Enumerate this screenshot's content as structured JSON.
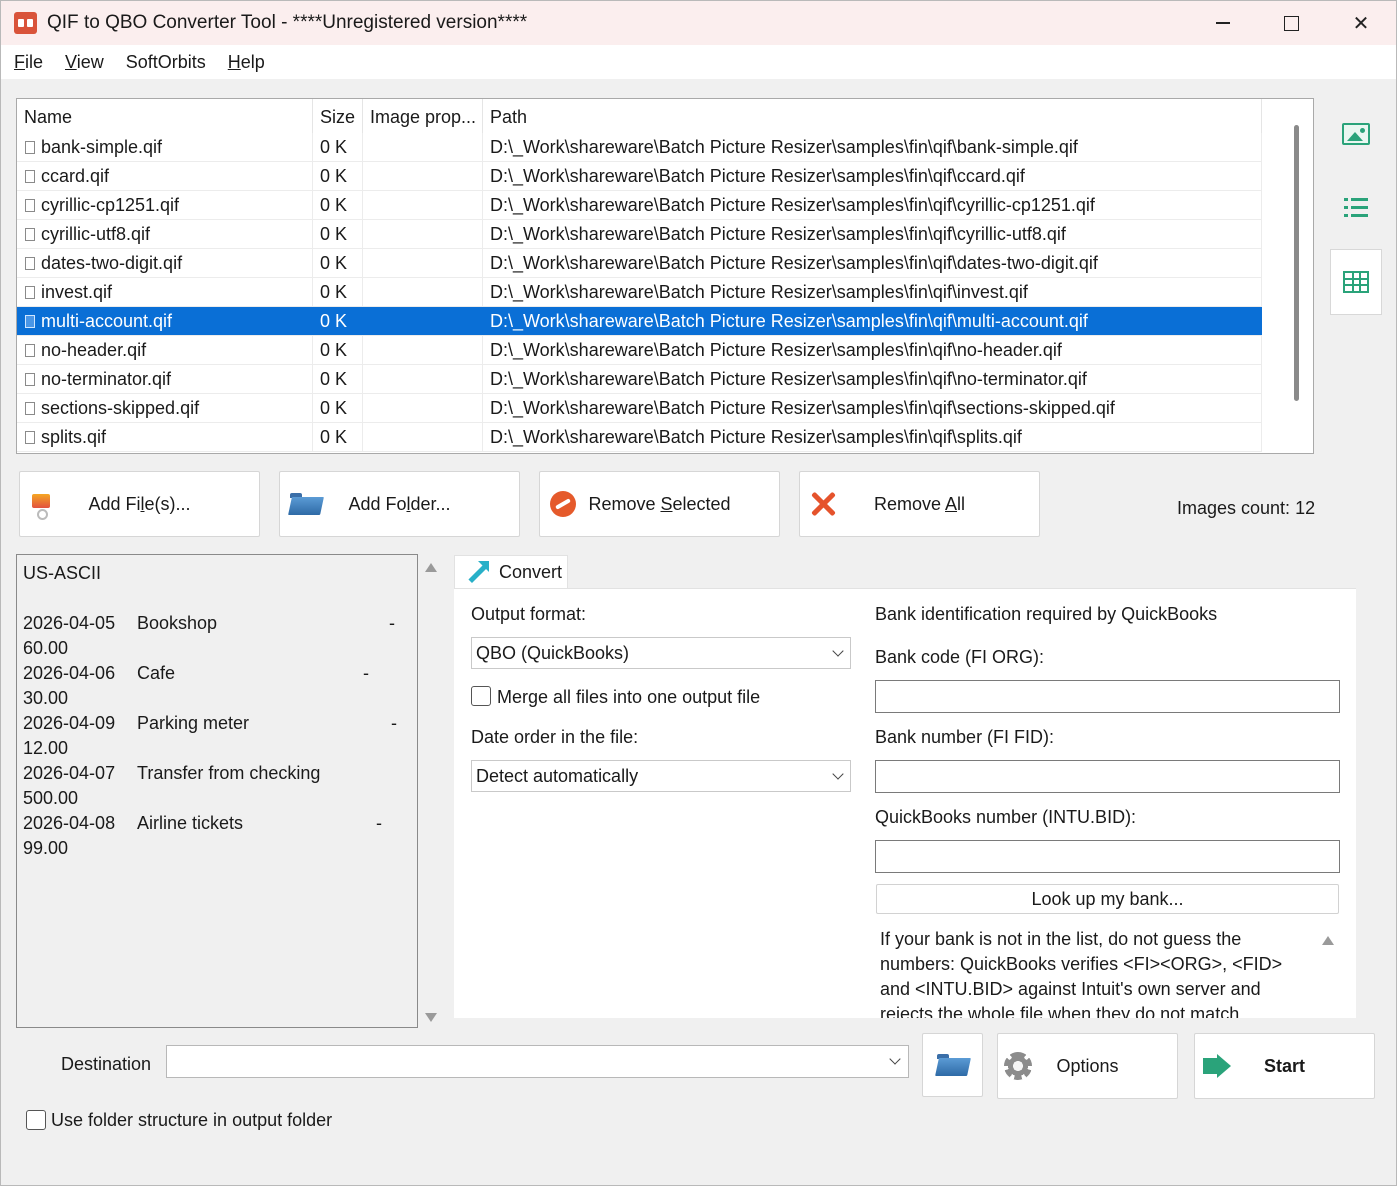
{
  "window": {
    "title": "QIF to QBO Converter Tool - ****Unregistered version****"
  },
  "menu": {
    "items": [
      {
        "pre": "",
        "u": "F",
        "post": "ile"
      },
      {
        "pre": "",
        "u": "V",
        "post": "iew"
      },
      {
        "pre": "SoftOrbits",
        "u": "",
        "post": ""
      },
      {
        "pre": "",
        "u": "H",
        "post": "elp"
      }
    ]
  },
  "file_list": {
    "columns": [
      "Name",
      "Size",
      "Image prop...",
      "Path"
    ],
    "rows": [
      {
        "name": "bank-simple.qif",
        "size": "0 K",
        "image": "",
        "path": "D:\\_Work\\shareware\\Batch Picture Resizer\\samples\\fin\\qif\\bank-simple.qif"
      },
      {
        "name": "ccard.qif",
        "size": "0 K",
        "image": "",
        "path": "D:\\_Work\\shareware\\Batch Picture Resizer\\samples\\fin\\qif\\ccard.qif"
      },
      {
        "name": "cyrillic-cp1251.qif",
        "size": "0 K",
        "image": "",
        "path": "D:\\_Work\\shareware\\Batch Picture Resizer\\samples\\fin\\qif\\cyrillic-cp1251.qif"
      },
      {
        "name": "cyrillic-utf8.qif",
        "size": "0 K",
        "image": "",
        "path": "D:\\_Work\\shareware\\Batch Picture Resizer\\samples\\fin\\qif\\cyrillic-utf8.qif"
      },
      {
        "name": "dates-two-digit.qif",
        "size": "0 K",
        "image": "",
        "path": "D:\\_Work\\shareware\\Batch Picture Resizer\\samples\\fin\\qif\\dates-two-digit.qif"
      },
      {
        "name": "invest.qif",
        "size": "0 K",
        "image": "",
        "path": "D:\\_Work\\shareware\\Batch Picture Resizer\\samples\\fin\\qif\\invest.qif"
      },
      {
        "name": "multi-account.qif",
        "size": "0 K",
        "image": "",
        "path": "D:\\_Work\\shareware\\Batch Picture Resizer\\samples\\fin\\qif\\multi-account.qif",
        "selected": true
      },
      {
        "name": "no-header.qif",
        "size": "0 K",
        "image": "",
        "path": "D:\\_Work\\shareware\\Batch Picture Resizer\\samples\\fin\\qif\\no-header.qif"
      },
      {
        "name": "no-terminator.qif",
        "size": "0 K",
        "image": "",
        "path": "D:\\_Work\\shareware\\Batch Picture Resizer\\samples\\fin\\qif\\no-terminator.qif"
      },
      {
        "name": "sections-skipped.qif",
        "size": "0 K",
        "image": "",
        "path": "D:\\_Work\\shareware\\Batch Picture Resizer\\samples\\fin\\qif\\sections-skipped.qif"
      },
      {
        "name": "splits.qif",
        "size": "0 K",
        "image": "",
        "path": "D:\\_Work\\shareware\\Batch Picture Resizer\\samples\\fin\\qif\\splits.qif"
      }
    ]
  },
  "actions": {
    "add_files": {
      "pre": "Add Fi",
      "u": "l",
      "post": "e(s)..."
    },
    "add_folder": {
      "pre": "Add Fo",
      "u": "l",
      "post": "der..."
    },
    "remove_selected": {
      "pre": "Remove ",
      "u": "S",
      "post": "elected"
    },
    "remove_all": {
      "pre": "Remove ",
      "u": "A",
      "post": "ll"
    },
    "images_count": "Images count: 12"
  },
  "preview": {
    "encoding": "US-ASCII",
    "entries": [
      {
        "date": "2026-04-05",
        "desc": "Bookshop",
        "minus": "-",
        "amount": "60.00"
      },
      {
        "date": "2026-04-06",
        "desc": "Cafe",
        "minus": "-",
        "amount": "30.00"
      },
      {
        "date": "2026-04-09",
        "desc": "Parking meter",
        "minus": "-",
        "amount": "12.00"
      },
      {
        "date": "2026-04-07",
        "desc": "Transfer from checking",
        "minus": "",
        "amount": "500.00"
      },
      {
        "date": "2026-04-08",
        "desc": "Airline tickets",
        "minus": "-",
        "amount": "99.00"
      }
    ]
  },
  "convert_tab": {
    "tab_label": "Convert",
    "output_format_label": "Output format:",
    "output_format_value": "QBO (QuickBooks)",
    "merge_label": "Merge all files into one output file",
    "date_order_label": "Date order in the file:",
    "date_order_value": "Detect automatically",
    "bank_heading": "Bank identification required by QuickBooks",
    "bank_code_label": "Bank code (FI ORG):",
    "bank_number_label": "Bank number (FI FID):",
    "qb_number_label": "QuickBooks number (INTU.BID):",
    "lookup_button": "Look up my bank...",
    "info_text": "If your bank is not in the list, do not guess the numbers: QuickBooks verifies <FI><ORG>, <FID> and <INTU.BID> against Intuit's own server and rejects the whole file when they do not match."
  },
  "bottom": {
    "destination_label": "Destination",
    "options_button": "Options",
    "start_button": "Start",
    "folder_structure_label": "Use folder structure in output folder"
  },
  "icons": {
    "app": "app-icon",
    "side": [
      "image-view-icon",
      "list-view-icon",
      "table-view-icon"
    ]
  },
  "colors": {
    "selection": "#0a6fd6",
    "accent_green": "#2aa37a",
    "title_bar": "#fbeeee"
  }
}
